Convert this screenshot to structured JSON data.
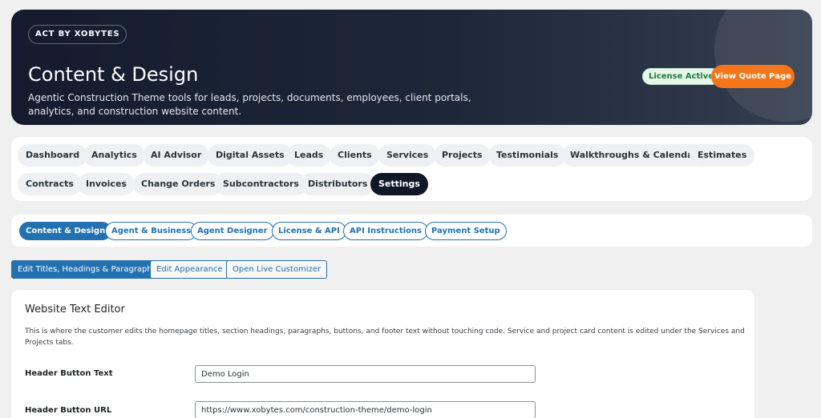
{
  "hero": {
    "brand": "ACT BY XOBYTES",
    "title": "Content & Design",
    "description": "Agentic Construction Theme tools for leads, projects, documents, employees, client portals, analytics, and construction website content.",
    "license_badge": "License Active",
    "quote_button": "View Quote Page"
  },
  "main_tabs": [
    {
      "label": "Dashboard"
    },
    {
      "label": "Analytics"
    },
    {
      "label": "AI Advisor"
    },
    {
      "label": "Digital Assets"
    },
    {
      "label": "Leads"
    },
    {
      "label": "Clients"
    },
    {
      "label": "Services"
    },
    {
      "label": "Projects"
    },
    {
      "label": "Testimonials"
    },
    {
      "label": "Walkthroughs & Calendar"
    },
    {
      "label": "Estimates"
    },
    {
      "label": "Contracts"
    },
    {
      "label": "Invoices"
    },
    {
      "label": "Change Orders"
    },
    {
      "label": "Subcontractors"
    },
    {
      "label": "Distributors"
    },
    {
      "label": "Settings",
      "active": true
    }
  ],
  "sub_tabs": [
    {
      "label": "Content & Design",
      "active": true
    },
    {
      "label": "Agent & Business"
    },
    {
      "label": "Agent Designer"
    },
    {
      "label": "License & API"
    },
    {
      "label": "API Instructions"
    },
    {
      "label": "Payment Setup"
    }
  ],
  "section_buttons": [
    {
      "label": "Edit Titles, Headings & Paragraphs",
      "active": true
    },
    {
      "label": "Edit Appearance"
    },
    {
      "label": "Open Live Customizer"
    }
  ],
  "editor": {
    "title": "Website Text Editor",
    "description": "This is where the customer edits the homepage titles, section headings, paragraphs, buttons, and footer text without touching code. Service and project card content is edited under the Services and Projects tabs.",
    "fields": [
      {
        "label": "Header Button Text",
        "value": "Demo Login"
      },
      {
        "label": "Header Button URL",
        "value": "https://www.xobytes.com/construction-theme/demo-login"
      }
    ]
  },
  "colors": {
    "hero_bg": "#141b2e",
    "accent_orange": "#f47619",
    "primary_blue": "#2271b1",
    "active_tab": "#101828",
    "license_green": "#1f7a3a"
  }
}
